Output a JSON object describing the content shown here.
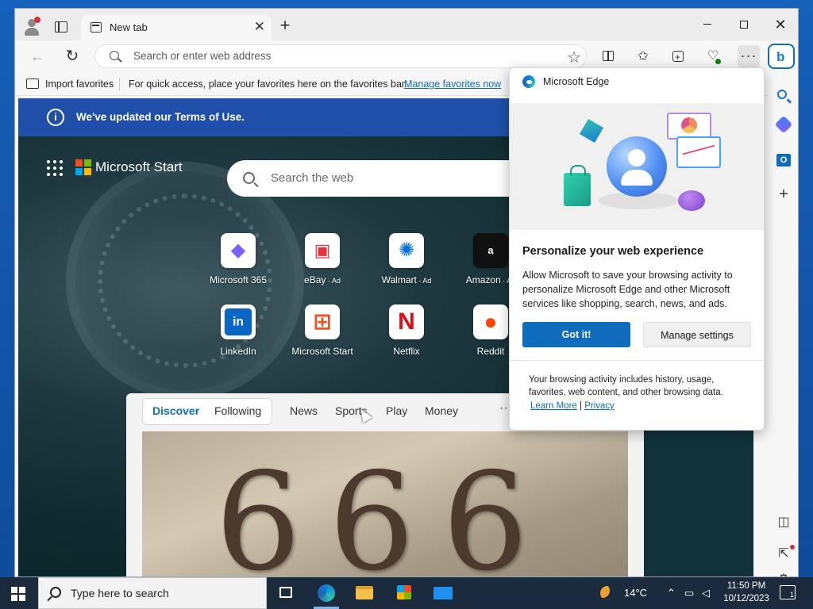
{
  "titlebar": {
    "tab_label": "New tab",
    "tab_close": "✕",
    "new_tab": "+",
    "minimize": "",
    "close": "✕"
  },
  "toolbar": {
    "back": "←",
    "refresh": "↻",
    "address_placeholder": "Search or enter web address",
    "favorite_star": "☆",
    "favorites_icon": "✩",
    "more": "···",
    "bing": "b"
  },
  "favbar": {
    "import": "Import favorites",
    "hint": "For quick access, place your favorites here on the favorites bar.",
    "manage_link": "Manage favorites now"
  },
  "banner": {
    "icon": "i",
    "text": "We've updated our Terms of Use."
  },
  "start": {
    "brand": "Microsoft Start",
    "search_placeholder": "Search the web"
  },
  "tiles": [
    {
      "label": "Microsoft 365",
      "ad": "",
      "glyph": "◆",
      "color": "#7b61ff"
    },
    {
      "label": "eBay",
      "ad": "Ad",
      "glyph": "▣",
      "color": "#e53238"
    },
    {
      "label": "Walmart",
      "ad": "Ad",
      "glyph": "✺",
      "color": "#0071dc"
    },
    {
      "label": "Amazon",
      "ad": "Ad",
      "glyph": "a",
      "color": "#ffffff"
    },
    {
      "label": "LinkedIn",
      "ad": "",
      "glyph": "in",
      "color": "#0a66c2"
    },
    {
      "label": "Microsoft Start",
      "ad": "",
      "glyph": "⊞",
      "color": "#f25022"
    },
    {
      "label": "Netflix",
      "ad": "",
      "glyph": "N",
      "color": "#e50914"
    },
    {
      "label": "Reddit",
      "ad": "",
      "glyph": "●",
      "color": "#ff4500"
    }
  ],
  "feed": {
    "tabs": [
      "Discover",
      "Following",
      "News",
      "Sports",
      "Play",
      "Money"
    ],
    "more": "···",
    "image_text": [
      "6",
      "6",
      "6"
    ]
  },
  "sidebar": {
    "plus": "+",
    "split": "◫",
    "external": "⇱",
    "settings": "⚙"
  },
  "popup": {
    "title": "Microsoft Edge",
    "heading": "Personalize your web experience",
    "body": "Allow Microsoft to save your browsing activity to personalize Microsoft Edge and other Microsoft services like shopping, search, news, and ads.",
    "got_it": "Got it!",
    "manage": "Manage settings",
    "footer": "Your browsing activity includes history, usage, favorites, web content, and other browsing data.",
    "learn_more": "Learn More",
    "separator": "|",
    "privacy": "Privacy"
  },
  "taskbar": {
    "search_placeholder": "Type here to search",
    "temperature": "14°C",
    "time": "11:50 PM",
    "date": "10/12/2023",
    "notifications": "1"
  },
  "colors": {
    "accent": "#0f6cbd",
    "banner": "#1f4fa8",
    "taskbar": "#1b2b3d"
  }
}
